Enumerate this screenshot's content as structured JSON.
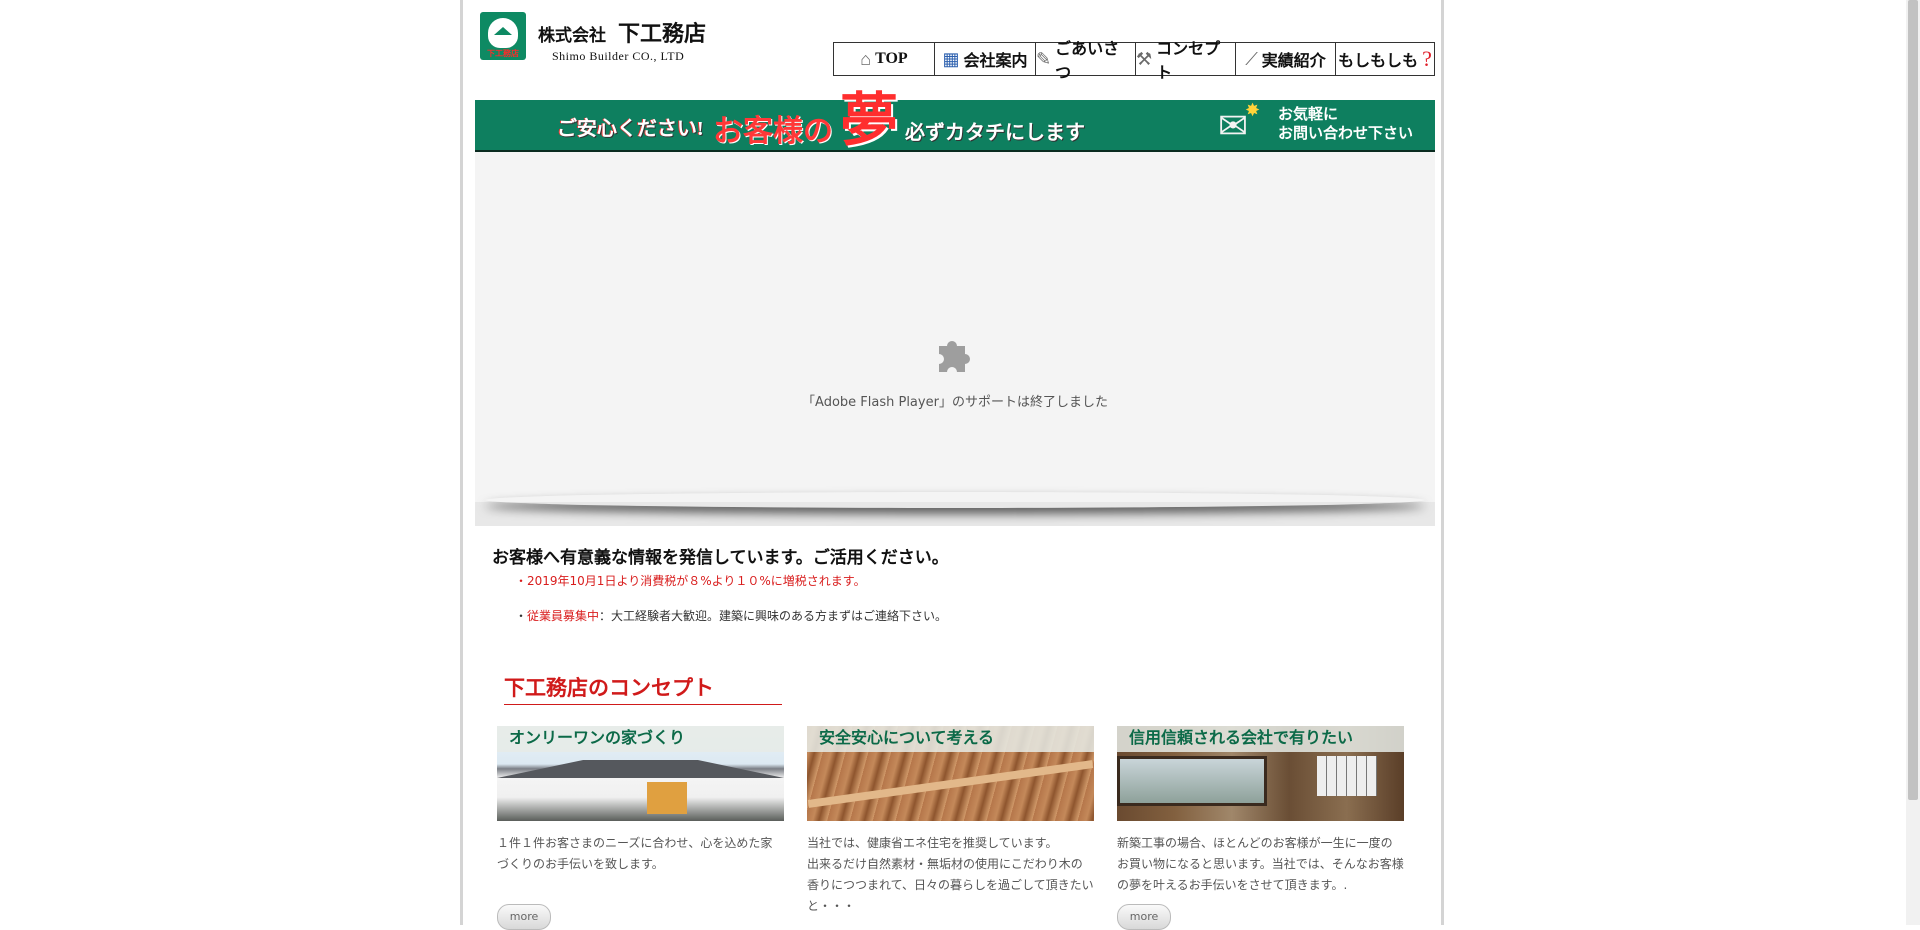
{
  "header": {
    "company_prefix": "株式会社",
    "company_name": "下工務店",
    "company_en": "Shimo Builder CO., LTD",
    "logo_mark": "下工務店"
  },
  "nav": [
    {
      "label": "TOP",
      "icon": "house-icon"
    },
    {
      "label": "会社案内",
      "icon": "building-icon"
    },
    {
      "label": "ごあいさつ",
      "icon": "pen-icon"
    },
    {
      "label": "コンセプト",
      "icon": "tools-icon"
    },
    {
      "label": "実績紹介",
      "icon": "drafting-icon"
    },
    {
      "label": "もしもしも",
      "icon": "question-icon"
    }
  ],
  "banner": {
    "part1": "ご安心ください!",
    "part2": "お客様の",
    "part3": "夢",
    "part4": "必ずカタチにします",
    "contact_line1": "お気軽に",
    "contact_line2": "お問い合わせ下さい"
  },
  "flash": {
    "message": "「Adobe Flash Player」のサポートは終了しました"
  },
  "info": {
    "title": "お客様へ有意義な情報を発信しています。ご活用ください。",
    "news1": "・2019年10月1日より消費税が８%より１０%に増税されます。",
    "news2_prefix": "・",
    "news2_highlight": "従業員募集中",
    "news2_rest": "：大工経験者大歓迎。建築に興味のある方まずはご連絡下さい。"
  },
  "concept": {
    "heading": "下工務店のコンセプト",
    "cards": [
      {
        "label": "オンリーワンの家づくり",
        "desc": "１件１件お客さまのニーズに合わせ、心を込めた家づくりのお手伝いを致します。",
        "more": "more"
      },
      {
        "label": "安全安心について考える",
        "desc": "当社では、健康省エネ住宅を推奨しています。\n出来るだけ自然素材・無垢材の使用にこだわり木の香りにつつまれて、日々の暮らしを過ごして頂きたいと・・・",
        "more": ""
      },
      {
        "label": "信用信頼される会社で有りたい",
        "desc": "新築工事の場合、ほとんどのお客様が一生に一度のお買い物になると思います。当社では、そんなお客様の夢を叶えるお手伝いをさせて頂きます。.",
        "more": "more"
      }
    ]
  },
  "colors": {
    "brand_green": "#0e7f5f",
    "accent_red": "#d01a1a"
  }
}
